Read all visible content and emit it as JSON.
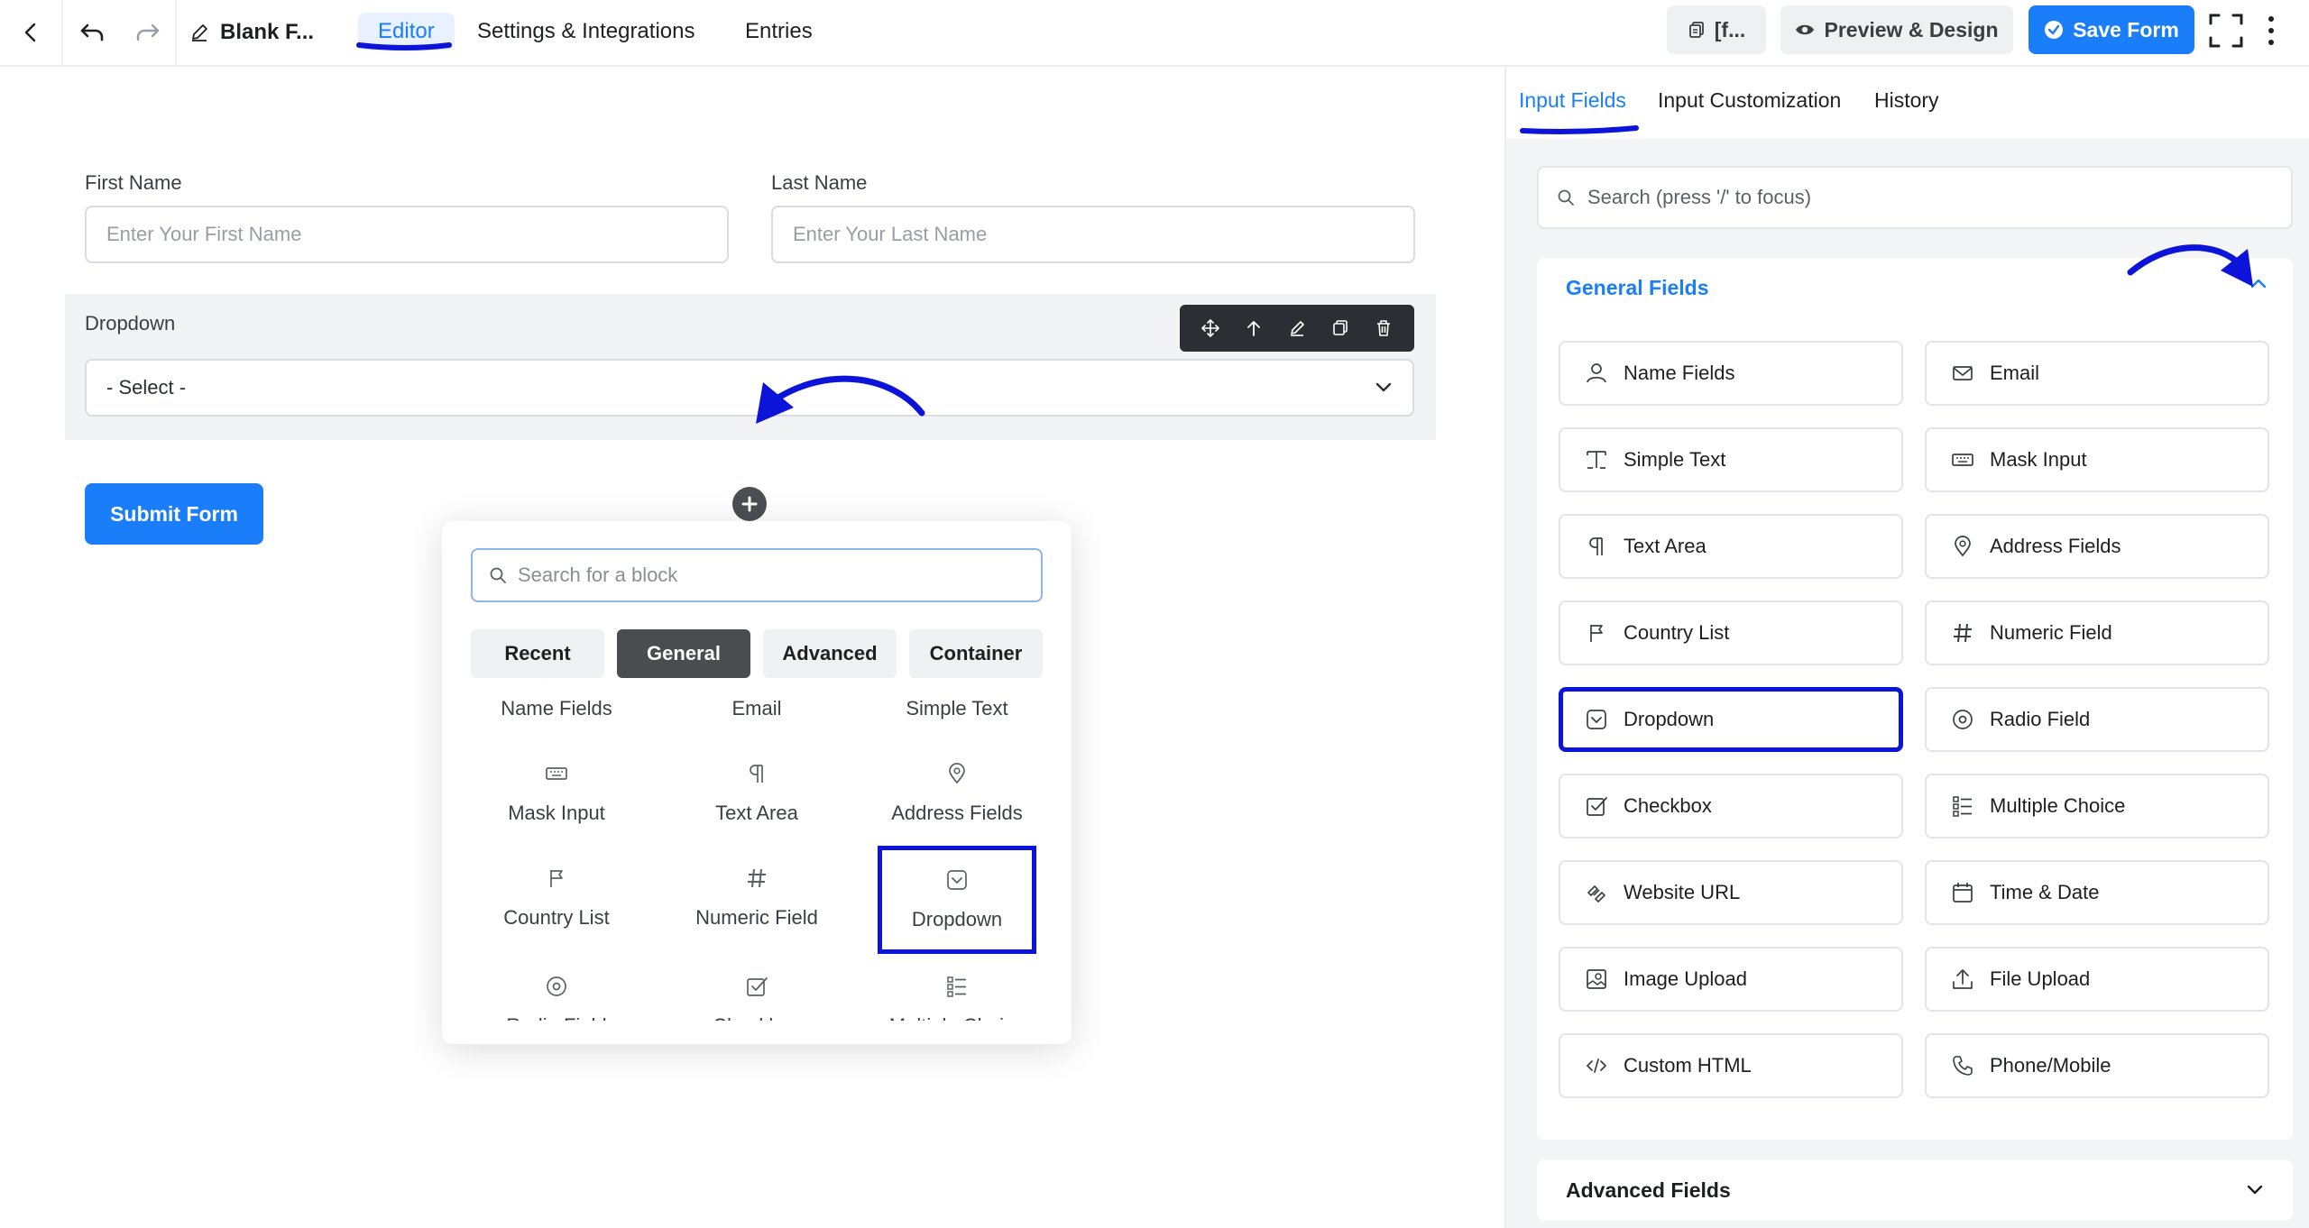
{
  "header": {
    "form_title": "Blank F...",
    "tabs": [
      {
        "label": "Editor",
        "active": true
      },
      {
        "label": "Settings & Integrations",
        "active": false
      },
      {
        "label": "Entries",
        "active": false
      }
    ],
    "shortcode_label": "[f...",
    "preview_label": "Preview & Design",
    "save_label": "Save Form"
  },
  "form": {
    "first_name": {
      "label": "First Name",
      "placeholder": "Enter Your First Name"
    },
    "last_name": {
      "label": "Last Name",
      "placeholder": "Enter Your Last Name"
    },
    "dropdown": {
      "label": "Dropdown",
      "selected": "- Select -"
    },
    "submit_label": "Submit Form"
  },
  "block_picker": {
    "search_placeholder": "Search for a block",
    "tabs": [
      {
        "label": "Recent",
        "active": false
      },
      {
        "label": "General",
        "active": true
      },
      {
        "label": "Advanced",
        "active": false
      },
      {
        "label": "Container",
        "active": false
      }
    ],
    "items": [
      {
        "label": "Name Fields",
        "icon": "user-icon"
      },
      {
        "label": "Email",
        "icon": "mail-icon"
      },
      {
        "label": "Simple Text",
        "icon": "text-cursor-icon"
      },
      {
        "label": "Mask Input",
        "icon": "keyboard-icon"
      },
      {
        "label": "Text Area",
        "icon": "paragraph-icon"
      },
      {
        "label": "Address Fields",
        "icon": "map-pin-icon"
      },
      {
        "label": "Country List",
        "icon": "flag-icon"
      },
      {
        "label": "Numeric Field",
        "icon": "hash-icon"
      },
      {
        "label": "Dropdown",
        "icon": "dropdown-icon",
        "highlighted": true
      },
      {
        "label": "Radio Field",
        "icon": "radio-icon"
      },
      {
        "label": "Checkbox",
        "icon": "checkbox-icon"
      },
      {
        "label": "Multiple Choice",
        "icon": "list-icon"
      }
    ]
  },
  "sidebar": {
    "tabs": [
      {
        "label": "Input Fields",
        "active": true
      },
      {
        "label": "Input Customization",
        "active": false
      },
      {
        "label": "History",
        "active": false
      }
    ],
    "search_placeholder": "Search (press '/' to focus)",
    "general_title": "General Fields",
    "general_fields": [
      {
        "label": "Name Fields",
        "icon": "user-icon"
      },
      {
        "label": "Email",
        "icon": "mail-icon"
      },
      {
        "label": "Simple Text",
        "icon": "text-cursor-icon"
      },
      {
        "label": "Mask Input",
        "icon": "keyboard-icon"
      },
      {
        "label": "Text Area",
        "icon": "paragraph-icon"
      },
      {
        "label": "Address Fields",
        "icon": "map-pin-icon"
      },
      {
        "label": "Country List",
        "icon": "flag-icon"
      },
      {
        "label": "Numeric Field",
        "icon": "hash-icon"
      },
      {
        "label": "Dropdown",
        "icon": "dropdown-icon",
        "highlighted": true
      },
      {
        "label": "Radio Field",
        "icon": "radio-icon"
      },
      {
        "label": "Checkbox",
        "icon": "checkbox-icon"
      },
      {
        "label": "Multiple Choice",
        "icon": "list-icon"
      },
      {
        "label": "Website URL",
        "icon": "link-icon"
      },
      {
        "label": "Time & Date",
        "icon": "calendar-icon"
      },
      {
        "label": "Image Upload",
        "icon": "image-icon"
      },
      {
        "label": "File Upload",
        "icon": "upload-icon"
      },
      {
        "label": "Custom HTML",
        "icon": "code-icon"
      },
      {
        "label": "Phone/Mobile",
        "icon": "phone-icon"
      }
    ],
    "advanced_title": "Advanced Fields"
  },
  "colors": {
    "accent": "#1a7efb",
    "annotation": "#0b14d8",
    "dark_toolbar": "#2b2e33"
  }
}
